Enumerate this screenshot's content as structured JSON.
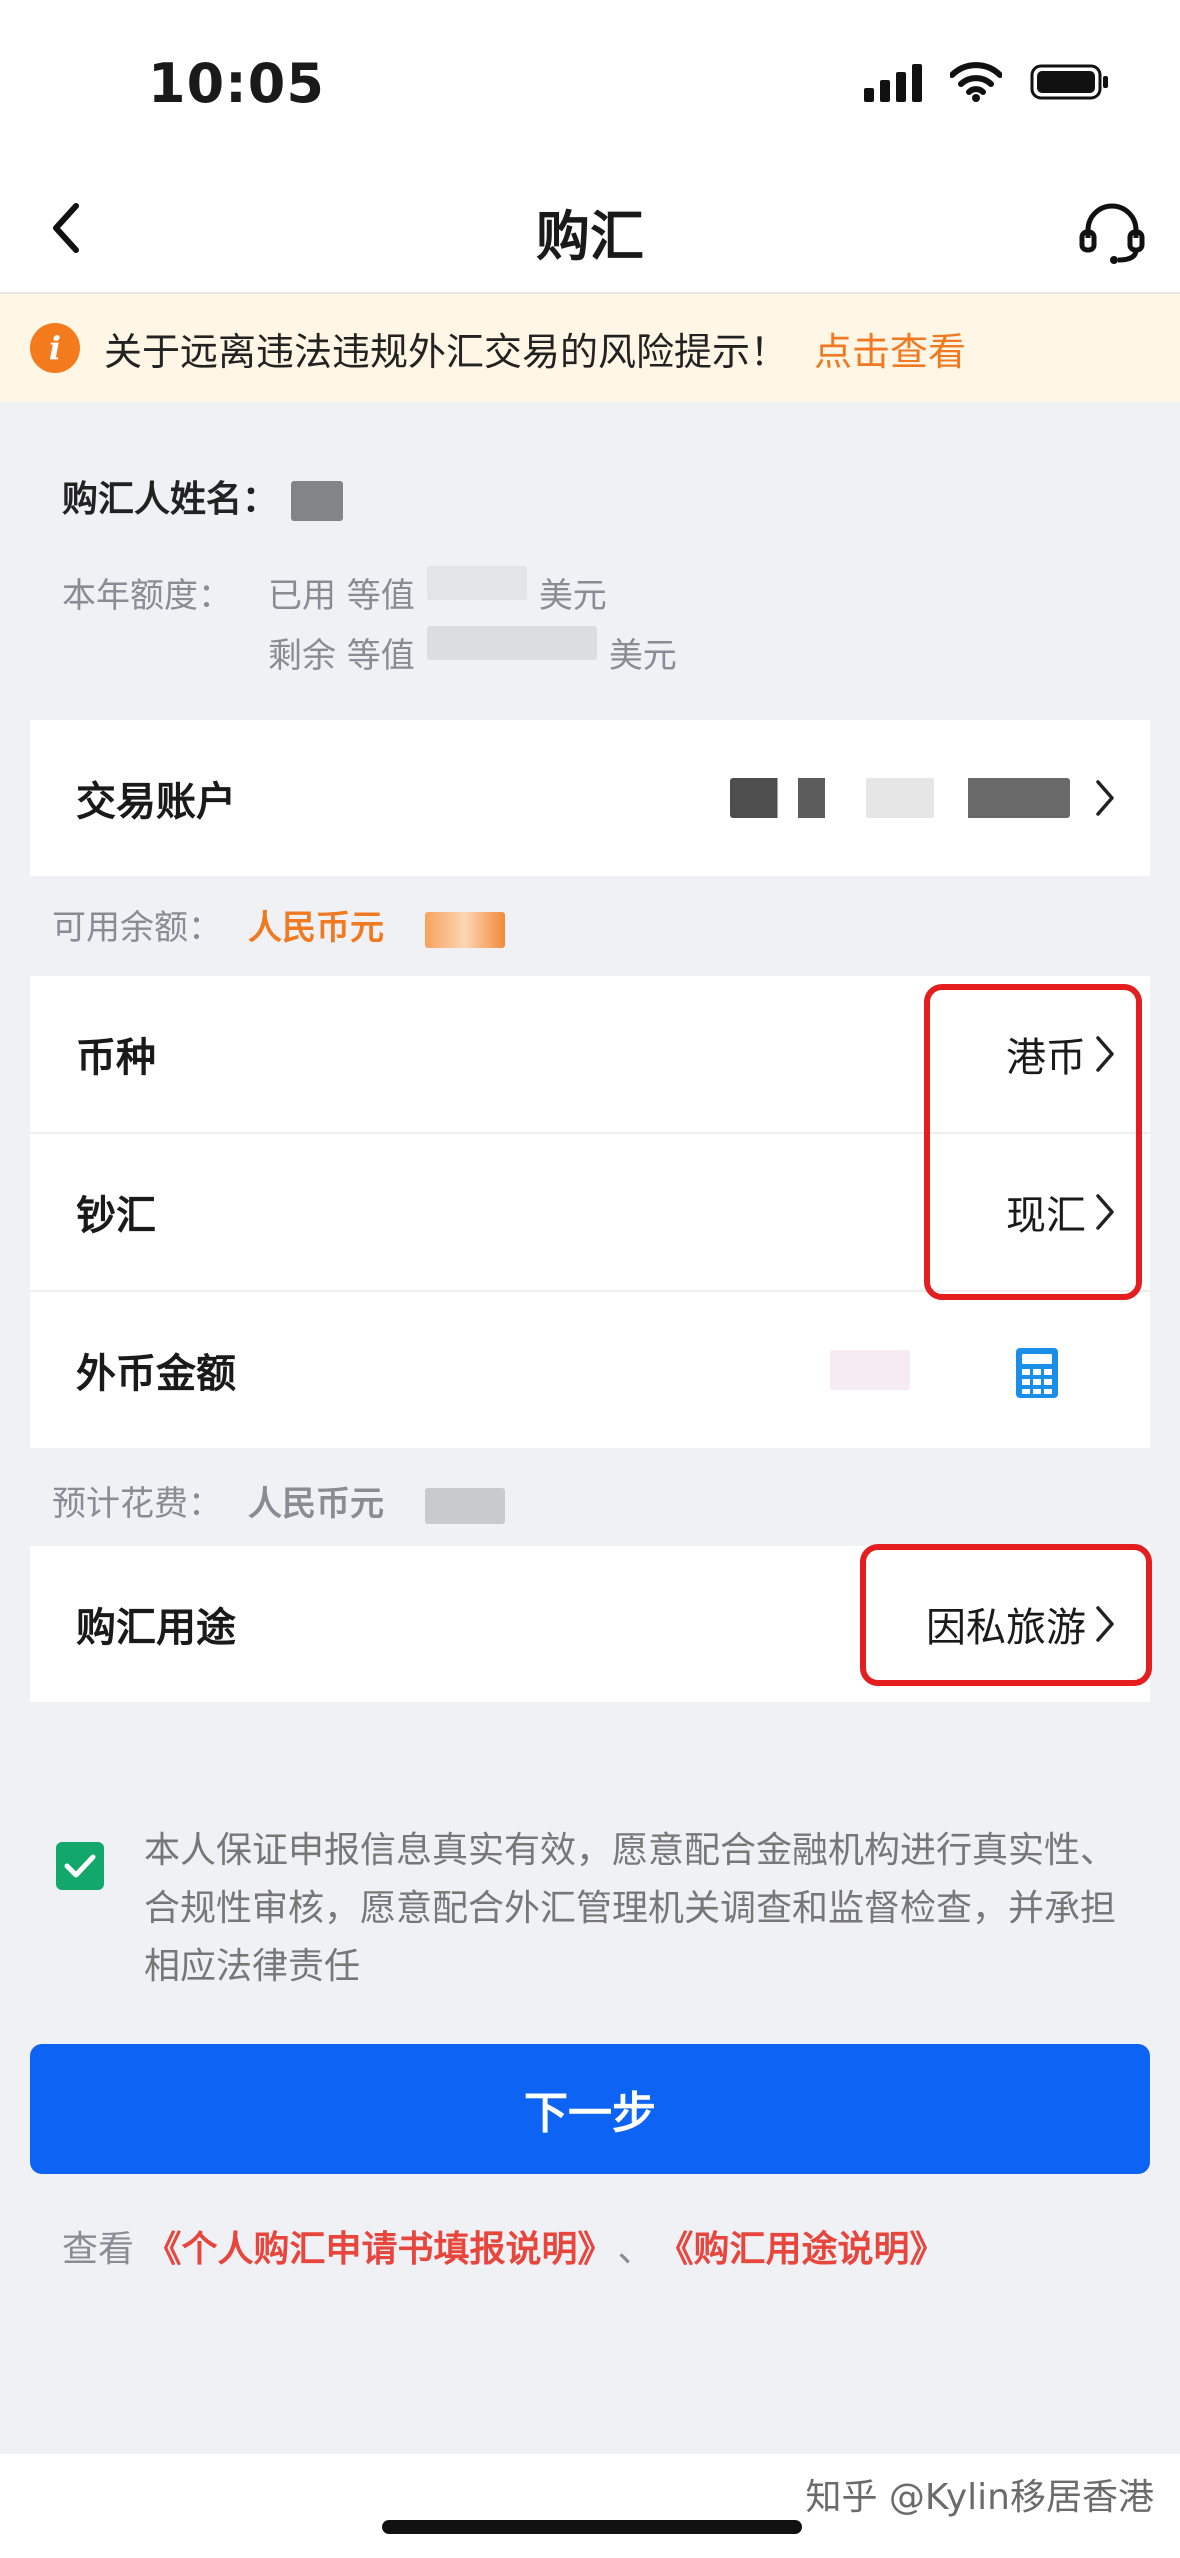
{
  "status_bar": {
    "time": "10:05"
  },
  "nav": {
    "title": "购汇"
  },
  "notice": {
    "text": "关于远离违法违规外汇交易的风险提示！",
    "link": "点击查看"
  },
  "holder": {
    "label": "购汇人姓名："
  },
  "quota": {
    "label": "本年额度：",
    "used_prefix": "已用 等值",
    "used_suffix": "美元",
    "remain_prefix": "剩余 等值",
    "remain_suffix": "美元"
  },
  "account": {
    "label": "交易账户"
  },
  "balance": {
    "label": "可用余额：",
    "currency": "人民币元"
  },
  "currency_row": {
    "label": "币种",
    "value": "港币"
  },
  "cash_row": {
    "label": "钞汇",
    "value": "现汇"
  },
  "amount_row": {
    "label": "外币金额",
    "icon": "calculator-icon"
  },
  "estimate": {
    "label": "预计花费：",
    "currency": "人民币元"
  },
  "purpose_row": {
    "label": "购汇用途",
    "value": "因私旅游"
  },
  "declaration": {
    "checked": true,
    "text": "本人保证申报信息真实有效，愿意配合金融机构进行真实性、合规性审核，愿意配合外汇管理机关调查和监督检查，并承担相应法律责任"
  },
  "next_button": {
    "label": "下一步"
  },
  "links": {
    "prefix": "查看",
    "link1": "《个人购汇申请书填报说明》",
    "separator": "、",
    "link2": "《购汇用途说明》"
  },
  "watermark": "知乎 @Kylin移居香港",
  "colors": {
    "primary": "#0d63f3",
    "accent_orange": "#f07a22",
    "highlight_red": "#e41e1e",
    "check_green": "#13a86b",
    "link_red": "#e8453c"
  }
}
